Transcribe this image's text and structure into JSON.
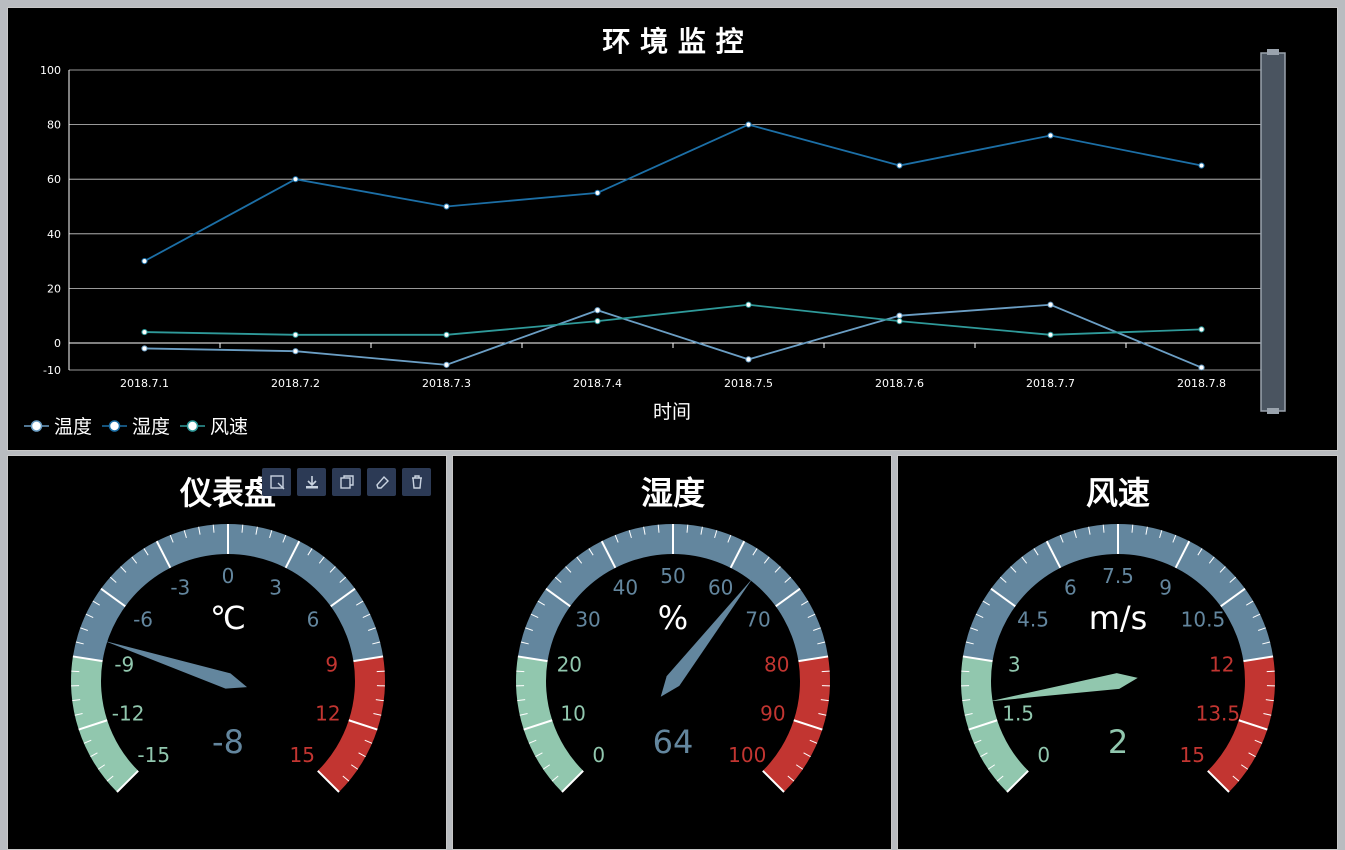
{
  "line_chart": {
    "title": "环 境 监 控",
    "xlabel": "时间"
  },
  "chart_data": [
    {
      "type": "line",
      "title": "环 境 监 控",
      "xlabel": "时间",
      "ylabel": "",
      "categories": [
        "2018.7.1",
        "2018.7.2",
        "2018.7.3",
        "2018.7.4",
        "2018.7.5",
        "2018.7.6",
        "2018.7.7",
        "2018.7.8"
      ],
      "y_ticks": [
        -10,
        0,
        20,
        40,
        60,
        80,
        100
      ],
      "ylim": [
        -10,
        100
      ],
      "grid": true,
      "legend_position": "bottom-left",
      "series": [
        {
          "name": "温度",
          "color": "#6b9ec4",
          "values": [
            -2,
            -3,
            -8,
            12,
            -6,
            10,
            14,
            -9
          ]
        },
        {
          "name": "湿度",
          "color": "#1c6fa6",
          "values": [
            30,
            60,
            50,
            55,
            80,
            65,
            76,
            65
          ]
        },
        {
          "name": "风速",
          "color": "#2f9a9a",
          "values": [
            4,
            3,
            3,
            8,
            14,
            8,
            3,
            5
          ]
        }
      ]
    }
  ],
  "legend": [
    "温度",
    "湿度",
    "风速"
  ],
  "toolbox": {
    "icons": [
      "data-zoom-icon",
      "download-icon",
      "copy-icon",
      "eraser-icon",
      "trash-icon"
    ]
  },
  "gauges": [
    {
      "title": "仪表盘",
      "unit": "℃",
      "value": -8,
      "value_text": "-8",
      "min": -15,
      "max": 15,
      "labels": [
        "-15",
        "-12",
        "-9",
        "-6",
        "-3",
        "0",
        "3",
        "6",
        "9",
        "12",
        "15"
      ]
    },
    {
      "title": "湿度",
      "unit": "%",
      "value": 64,
      "value_text": "64",
      "min": 0,
      "max": 100,
      "labels": [
        "0",
        "10",
        "20",
        "30",
        "40",
        "50",
        "60",
        "70",
        "80",
        "90",
        "100"
      ]
    },
    {
      "title": "风速",
      "unit": "m/s",
      "value": 2,
      "value_text": "2",
      "min": 0,
      "max": 15,
      "labels": [
        "0",
        "1.5",
        "3",
        "4.5",
        "6",
        "7.5",
        "9",
        "10.5",
        "12",
        "13.5",
        "15"
      ]
    }
  ],
  "colors": {
    "low": "#91c7ae",
    "mid": "#63869e",
    "high": "#c23531",
    "axis": "#ffffff",
    "grid": "#cccccc"
  }
}
